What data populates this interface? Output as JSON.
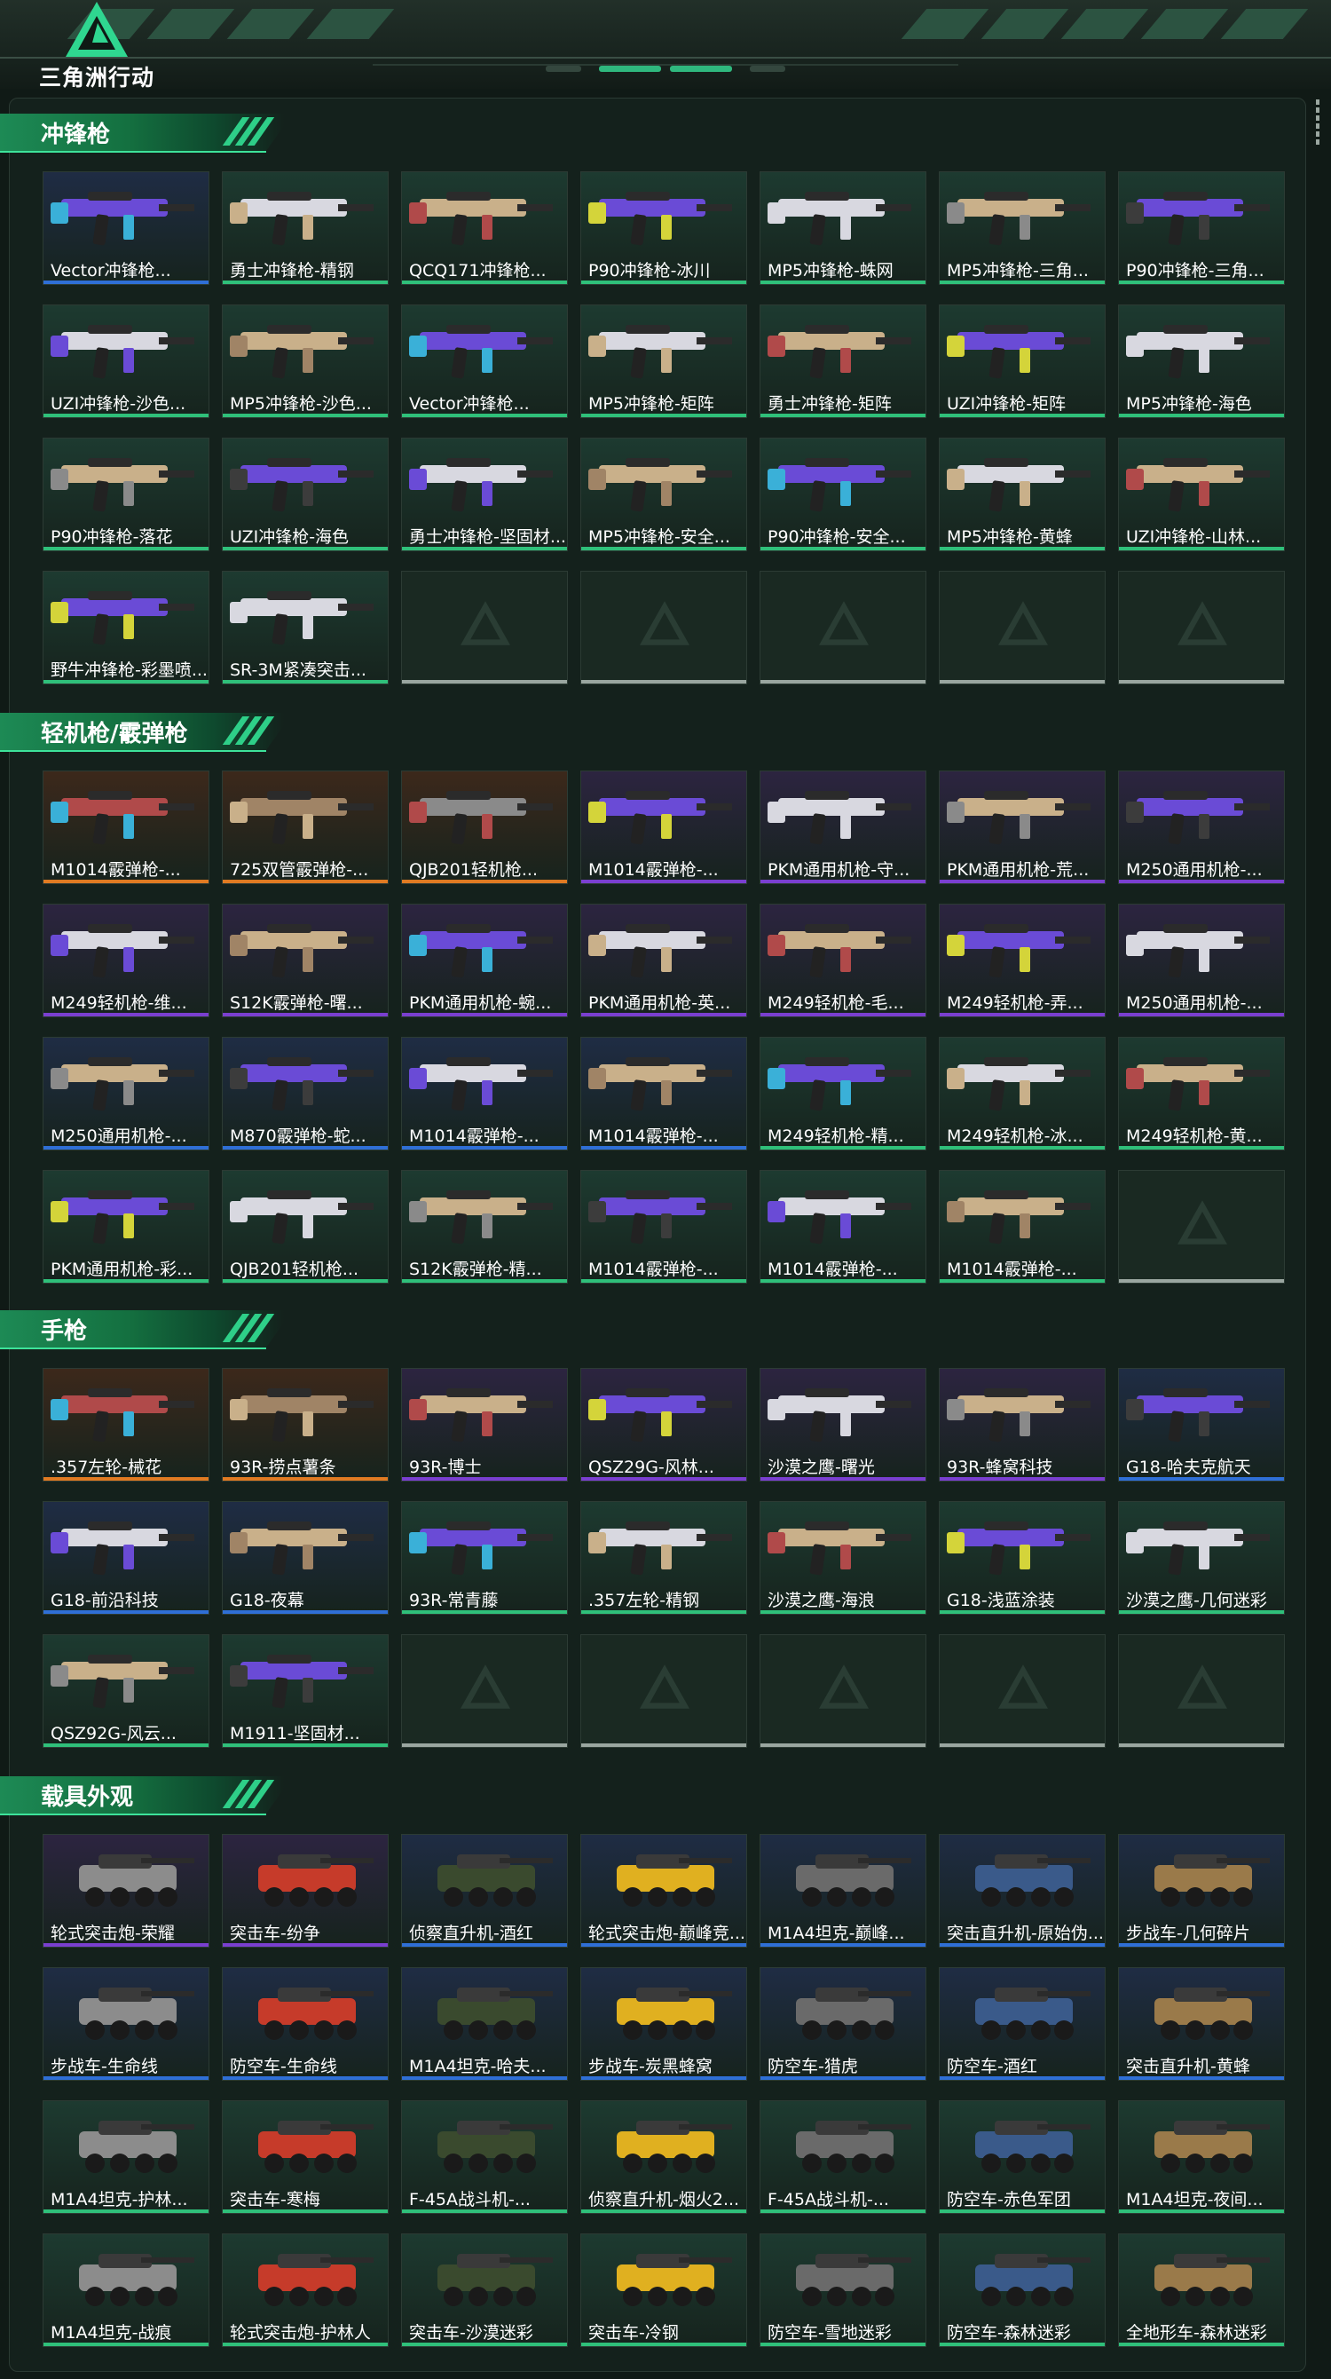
{
  "app": {
    "logo_text": "三角洲行动",
    "logo_icon": "delta-triangle-logo"
  },
  "colors": {
    "accent": "#2ecf88",
    "rarity": {
      "green": "#2fc07a",
      "blue": "#2f6fd6",
      "purple": "#7a3fd0",
      "orange": "#e07a22",
      "white": "#9aa6a0"
    },
    "tint": {
      "green": "#1d3a30",
      "blue": "#1f2c44",
      "purple": "#2c2440",
      "orange": "#3c281b"
    }
  },
  "sections": [
    {
      "title": "冲锋枪",
      "items": [
        {
          "label": "Vector冲锋枪...",
          "rarity": "blue"
        },
        {
          "label": "勇士冲锋枪-精钢",
          "rarity": "green"
        },
        {
          "label": "QCQ171冲锋枪...",
          "rarity": "green"
        },
        {
          "label": "P90冲锋枪-冰川",
          "rarity": "green"
        },
        {
          "label": "MP5冲锋枪-蛛网",
          "rarity": "green"
        },
        {
          "label": "MP5冲锋枪-三角...",
          "rarity": "green"
        },
        {
          "label": "P90冲锋枪-三角...",
          "rarity": "green"
        },
        {
          "label": "UZI冲锋枪-沙色...",
          "rarity": "green"
        },
        {
          "label": "MP5冲锋枪-沙色...",
          "rarity": "green"
        },
        {
          "label": "Vector冲锋枪...",
          "rarity": "green"
        },
        {
          "label": "MP5冲锋枪-矩阵",
          "rarity": "green"
        },
        {
          "label": "勇士冲锋枪-矩阵",
          "rarity": "green"
        },
        {
          "label": "UZI冲锋枪-矩阵",
          "rarity": "green"
        },
        {
          "label": "MP5冲锋枪-海色",
          "rarity": "green"
        },
        {
          "label": "P90冲锋枪-落花",
          "rarity": "green"
        },
        {
          "label": "UZI冲锋枪-海色",
          "rarity": "green"
        },
        {
          "label": "勇士冲锋枪-坚固材...",
          "rarity": "green"
        },
        {
          "label": "MP5冲锋枪-安全...",
          "rarity": "green"
        },
        {
          "label": "P90冲锋枪-安全...",
          "rarity": "green"
        },
        {
          "label": "MP5冲锋枪-黄蜂",
          "rarity": "green"
        },
        {
          "label": "UZI冲锋枪-山林...",
          "rarity": "green"
        },
        {
          "label": "野牛冲锋枪-彩墨喷...",
          "rarity": "green"
        },
        {
          "label": "SR-3M紧凑突击...",
          "rarity": "green"
        },
        {
          "label": "",
          "rarity": "empty"
        },
        {
          "label": "",
          "rarity": "empty"
        },
        {
          "label": "",
          "rarity": "empty"
        },
        {
          "label": "",
          "rarity": "empty"
        },
        {
          "label": "",
          "rarity": "empty"
        }
      ]
    },
    {
      "title": "轻机枪/霰弹枪",
      "items": [
        {
          "label": "M1014霰弹枪-...",
          "rarity": "orange"
        },
        {
          "label": "725双管霰弹枪-...",
          "rarity": "orange"
        },
        {
          "label": "QJB201轻机枪...",
          "rarity": "orange"
        },
        {
          "label": "M1014霰弹枪-...",
          "rarity": "purple"
        },
        {
          "label": "PKM通用机枪-守...",
          "rarity": "purple"
        },
        {
          "label": "PKM通用机枪-荒...",
          "rarity": "purple"
        },
        {
          "label": "M250通用机枪-...",
          "rarity": "purple"
        },
        {
          "label": "M249轻机枪-维...",
          "rarity": "purple"
        },
        {
          "label": "S12K霰弹枪-曙...",
          "rarity": "purple"
        },
        {
          "label": "PKM通用机枪-蜿...",
          "rarity": "purple"
        },
        {
          "label": "PKM通用机枪-英...",
          "rarity": "purple"
        },
        {
          "label": "M249轻机枪-毛...",
          "rarity": "purple"
        },
        {
          "label": "M249轻机枪-弄...",
          "rarity": "purple"
        },
        {
          "label": "M250通用机枪-...",
          "rarity": "purple"
        },
        {
          "label": "M250通用机枪-...",
          "rarity": "blue"
        },
        {
          "label": "M870霰弹枪-蛇...",
          "rarity": "blue"
        },
        {
          "label": "M1014霰弹枪-...",
          "rarity": "blue"
        },
        {
          "label": "M1014霰弹枪-...",
          "rarity": "blue"
        },
        {
          "label": "M249轻机枪-精...",
          "rarity": "green"
        },
        {
          "label": "M249轻机枪-冰...",
          "rarity": "green"
        },
        {
          "label": "M249轻机枪-黄...",
          "rarity": "green"
        },
        {
          "label": "PKM通用机枪-彩...",
          "rarity": "green"
        },
        {
          "label": "QJB201轻机枪...",
          "rarity": "green"
        },
        {
          "label": "S12K霰弹枪-精...",
          "rarity": "green"
        },
        {
          "label": "M1014霰弹枪-...",
          "rarity": "green"
        },
        {
          "label": "M1014霰弹枪-...",
          "rarity": "green"
        },
        {
          "label": "M1014霰弹枪-...",
          "rarity": "green"
        },
        {
          "label": "",
          "rarity": "empty"
        }
      ]
    },
    {
      "title": "手枪",
      "items": [
        {
          "label": ".357左轮-械花",
          "rarity": "orange"
        },
        {
          "label": "93R-捞点薯条",
          "rarity": "orange"
        },
        {
          "label": "93R-博士",
          "rarity": "purple"
        },
        {
          "label": "QSZ29G-风林...",
          "rarity": "purple"
        },
        {
          "label": "沙漠之鹰-曙光",
          "rarity": "purple"
        },
        {
          "label": "93R-蜂窝科技",
          "rarity": "purple"
        },
        {
          "label": "G18-哈夫克航天",
          "rarity": "blue"
        },
        {
          "label": "G18-前沿科技",
          "rarity": "blue"
        },
        {
          "label": "G18-夜幕",
          "rarity": "blue"
        },
        {
          "label": "93R-常青藤",
          "rarity": "green"
        },
        {
          "label": ".357左轮-精钢",
          "rarity": "green"
        },
        {
          "label": "沙漠之鹰-海浪",
          "rarity": "green"
        },
        {
          "label": "G18-浅蓝涂装",
          "rarity": "green"
        },
        {
          "label": "沙漠之鹰-几何迷彩",
          "rarity": "green"
        },
        {
          "label": "QSZ92G-风云...",
          "rarity": "green"
        },
        {
          "label": "M1911-坚固材...",
          "rarity": "green"
        },
        {
          "label": "",
          "rarity": "empty"
        },
        {
          "label": "",
          "rarity": "empty"
        },
        {
          "label": "",
          "rarity": "empty"
        },
        {
          "label": "",
          "rarity": "empty"
        },
        {
          "label": "",
          "rarity": "empty"
        }
      ]
    },
    {
      "title": "载具外观",
      "items": [
        {
          "label": "轮式突击炮-荣耀",
          "rarity": "purple"
        },
        {
          "label": "突击车-纷争",
          "rarity": "purple"
        },
        {
          "label": "侦察直升机-酒红",
          "rarity": "blue"
        },
        {
          "label": "轮式突击炮-巅峰竞...",
          "rarity": "blue"
        },
        {
          "label": "M1A4坦克-巅峰...",
          "rarity": "blue"
        },
        {
          "label": "突击直升机-原始伪...",
          "rarity": "blue"
        },
        {
          "label": "步战车-几何碎片",
          "rarity": "blue"
        },
        {
          "label": "步战车-生命线",
          "rarity": "blue"
        },
        {
          "label": "防空车-生命线",
          "rarity": "blue"
        },
        {
          "label": "M1A4坦克-哈夫...",
          "rarity": "blue"
        },
        {
          "label": "步战车-炭黑蜂窝",
          "rarity": "blue"
        },
        {
          "label": "防空车-猎虎",
          "rarity": "blue"
        },
        {
          "label": "防空车-酒红",
          "rarity": "blue"
        },
        {
          "label": "突击直升机-黄蜂",
          "rarity": "blue"
        },
        {
          "label": "M1A4坦克-护林...",
          "rarity": "green"
        },
        {
          "label": "突击车-寒梅",
          "rarity": "green"
        },
        {
          "label": "F-45A战斗机-...",
          "rarity": "green"
        },
        {
          "label": "侦察直升机-烟火2...",
          "rarity": "green"
        },
        {
          "label": "F-45A战斗机-...",
          "rarity": "green"
        },
        {
          "label": "防空车-赤色军团",
          "rarity": "green"
        },
        {
          "label": "M1A4坦克-夜间...",
          "rarity": "green"
        },
        {
          "label": "M1A4坦克-战痕",
          "rarity": "green"
        },
        {
          "label": "轮式突击炮-护林人",
          "rarity": "green"
        },
        {
          "label": "突击车-沙漠迷彩",
          "rarity": "green"
        },
        {
          "label": "突击车-冷钢",
          "rarity": "green"
        },
        {
          "label": "防空车-雪地迷彩",
          "rarity": "green"
        },
        {
          "label": "防空车-森林迷彩",
          "rarity": "green"
        },
        {
          "label": "全地形车-森林迷彩",
          "rarity": "green"
        }
      ]
    }
  ]
}
